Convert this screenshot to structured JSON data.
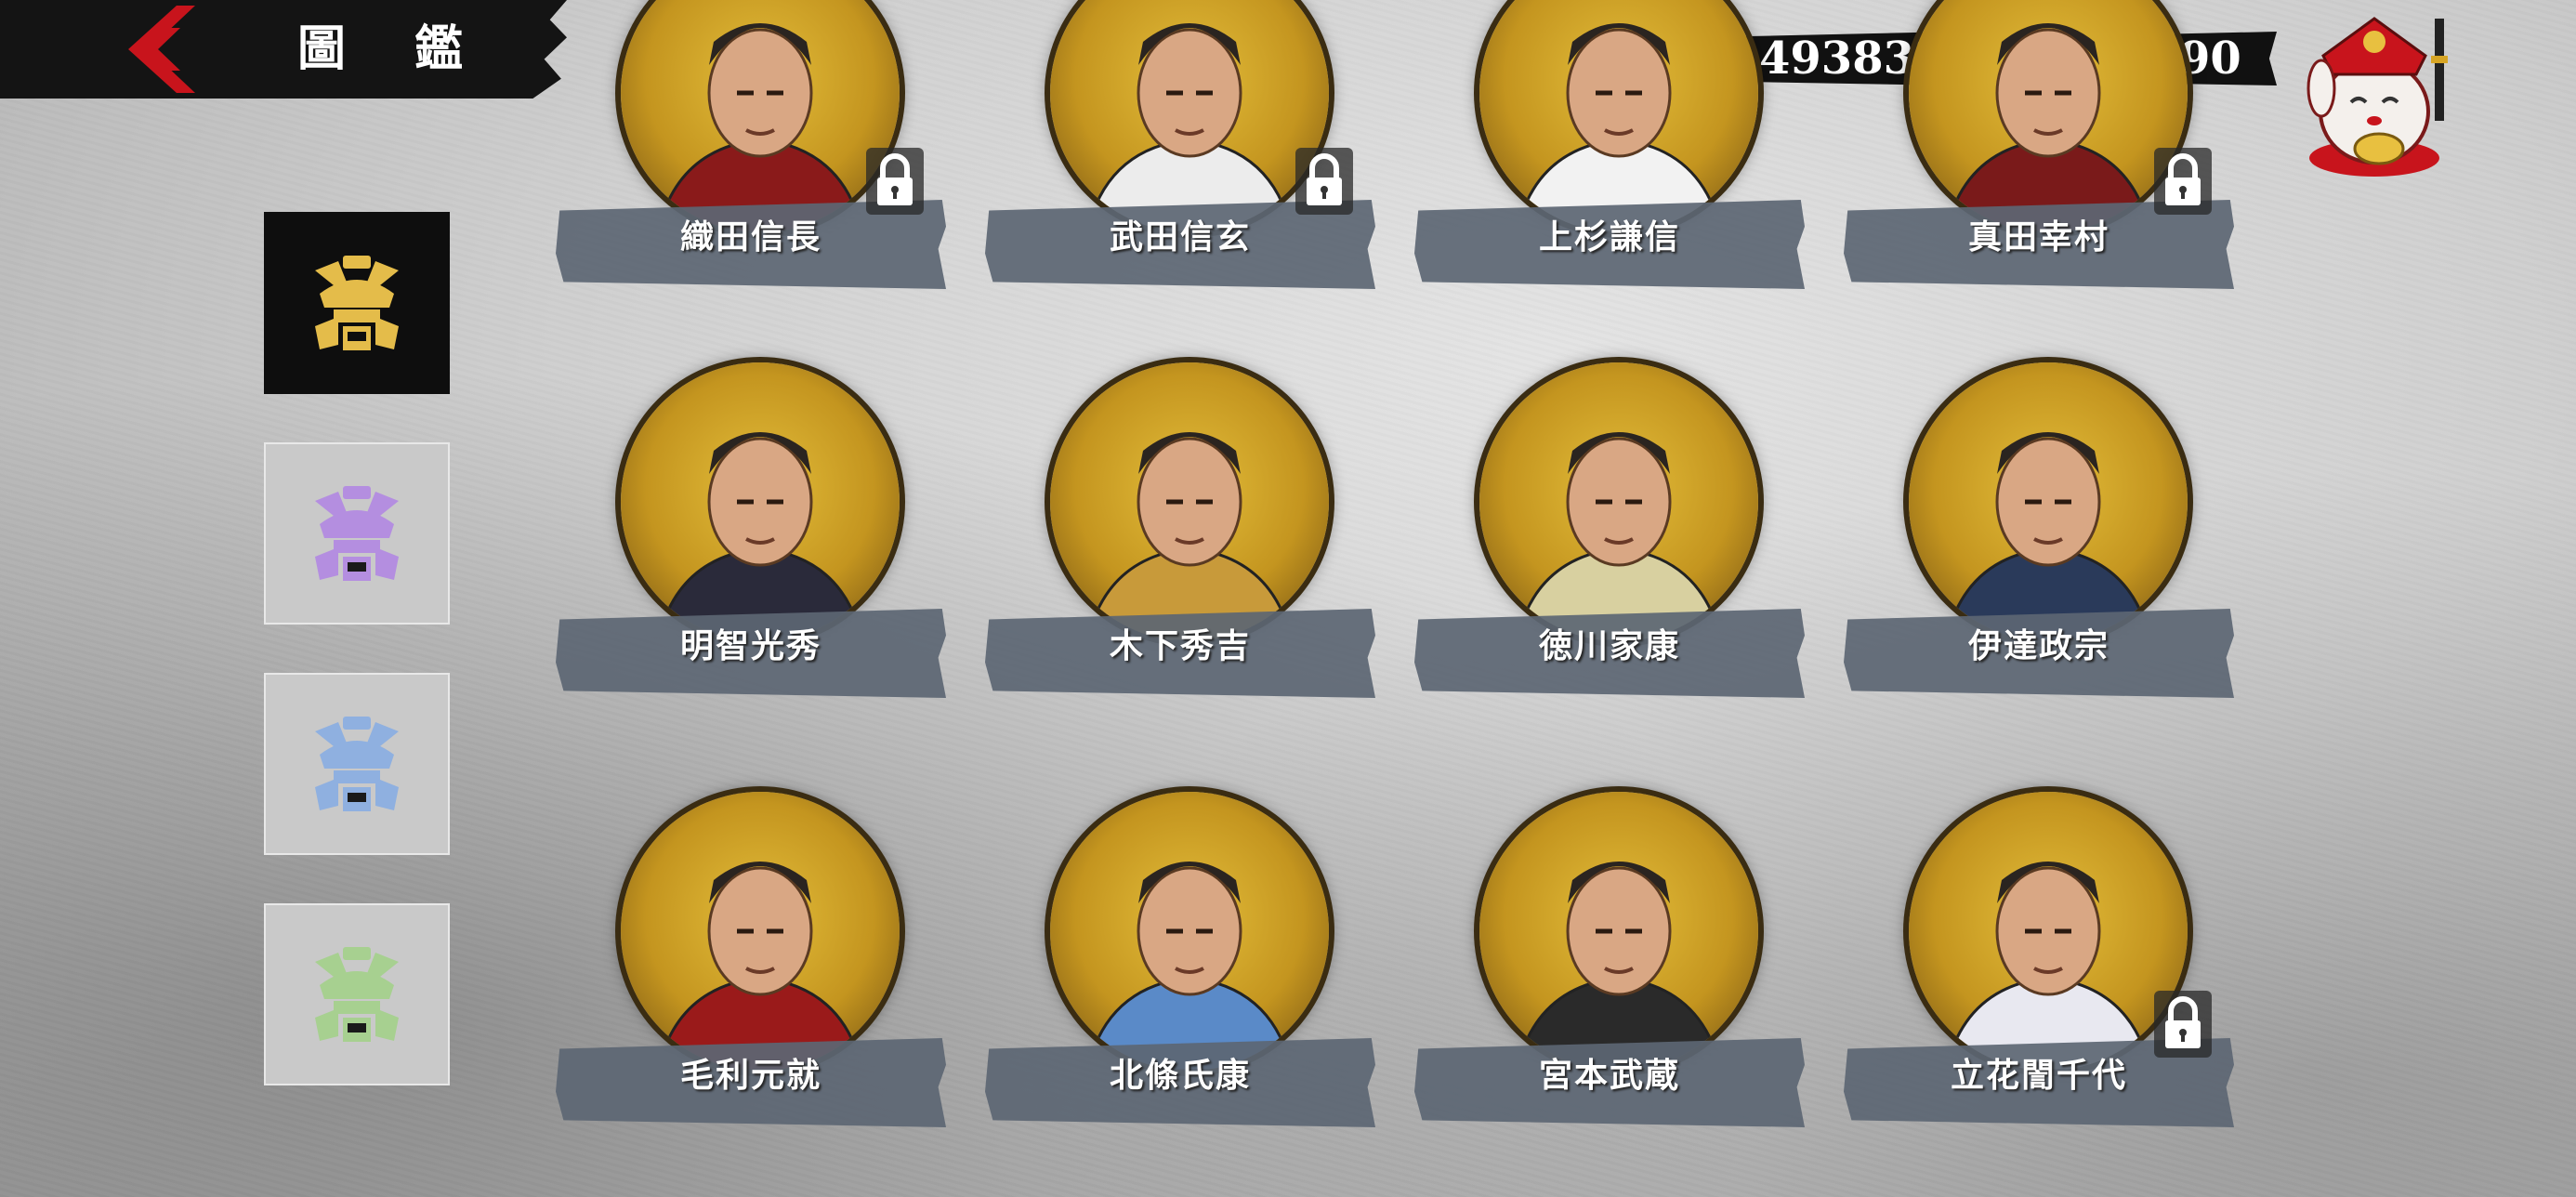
{
  "header": {
    "title": "圖 鑑",
    "back_icon": "back-arrow-icon"
  },
  "currency": {
    "coins": {
      "icon": "copper-coins-icon",
      "value": "4938325"
    },
    "gold": {
      "icon": "gold-bar-icon",
      "value": "9990"
    }
  },
  "shop_icon": "lucky-cat-icon",
  "sidebar": {
    "tabs": [
      {
        "icon": "kabuto-helmet-icon",
        "color": "#e4bc4a",
        "active": true
      },
      {
        "icon": "kabuto-helmet-icon",
        "color": "#b48ee0",
        "active": false
      },
      {
        "icon": "kabuto-helmet-icon",
        "color": "#8fb0e0",
        "active": false
      },
      {
        "icon": "kabuto-helmet-icon",
        "color": "#a7d090",
        "active": false
      }
    ]
  },
  "generals": [
    {
      "name": "織田信長",
      "locked": true
    },
    {
      "name": "武田信玄",
      "locked": true
    },
    {
      "name": "上杉謙信",
      "locked": false
    },
    {
      "name": "真田幸村",
      "locked": true
    },
    {
      "name": "明智光秀",
      "locked": false
    },
    {
      "name": "木下秀吉",
      "locked": false
    },
    {
      "name": "徳川家康",
      "locked": false
    },
    {
      "name": "伊達政宗",
      "locked": false
    },
    {
      "name": "毛利元就",
      "locked": false
    },
    {
      "name": "北條氏康",
      "locked": false
    },
    {
      "name": "宮本武蔵",
      "locked": false
    },
    {
      "name": "立花誾千代",
      "locked": true
    }
  ],
  "colors": {
    "accent_red": "#c8141c",
    "banner": "#5c6673",
    "portrait_gold": "#d4a628"
  }
}
